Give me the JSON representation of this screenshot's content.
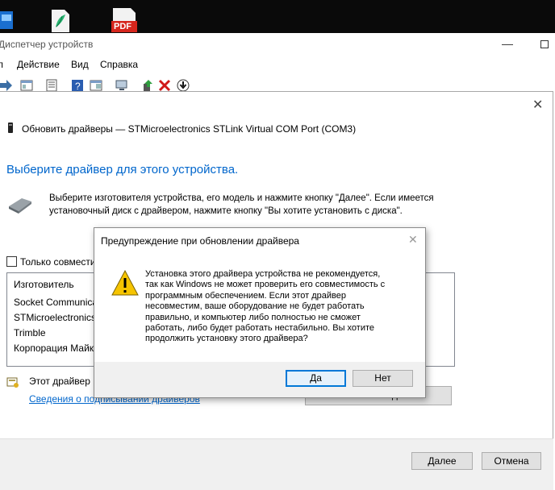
{
  "desktop": {
    "pdf_label": "PDF"
  },
  "device_manager": {
    "title": "Диспетчер устройств",
    "menu": [
      "Действие",
      "Вид",
      "Справка"
    ]
  },
  "wizard": {
    "title": "Обновить драйверы — STMicroelectronics STLink Virtual COM Port (COM3)",
    "heading": "Выберите драйвер для этого устройства.",
    "instruction": "Выберите изготовителя устройства, его модель и нажмите кнопку \"Далее\". Если имеется установочный диск с драйвером, нажмите кнопку \"Вы хотите установить с диска\".",
    "compatible_checkbox": "Только совмести",
    "manufacturer_header": "Изготовитель",
    "manufacturers": [
      "Socket Communica",
      "STMicroelectronics",
      "Trimble",
      "Корпорация Майк"
    ],
    "signed_text": "Этот драйвер и",
    "signing_link": "Сведения о подписывании драйверов",
    "have_disk_button": "Установить с диска...",
    "next_button": "Далее",
    "cancel_button": "Отмена"
  },
  "warning": {
    "title": "Предупреждение при обновлении драйвера",
    "message": "Установка этого драйвера устройства не рекомендуется,\nтак как Windows не может проверить его совместимость с\nпрограммным обеспечением.  Если этот драйвер\nнесовместим, ваше оборудование не будет работать\nправильно, и компьютер либо полностью не сможет\nработать, либо будет работать нестабильно.  Вы хотите\nпродолжить установку этого драйвера?",
    "yes_button": "Да",
    "no_button": "Нет"
  },
  "colors": {
    "accent_blue": "#0066cc",
    "link": "#0066cc",
    "warning_yellow": "#f6c400",
    "button_focus": "#0078d7"
  }
}
